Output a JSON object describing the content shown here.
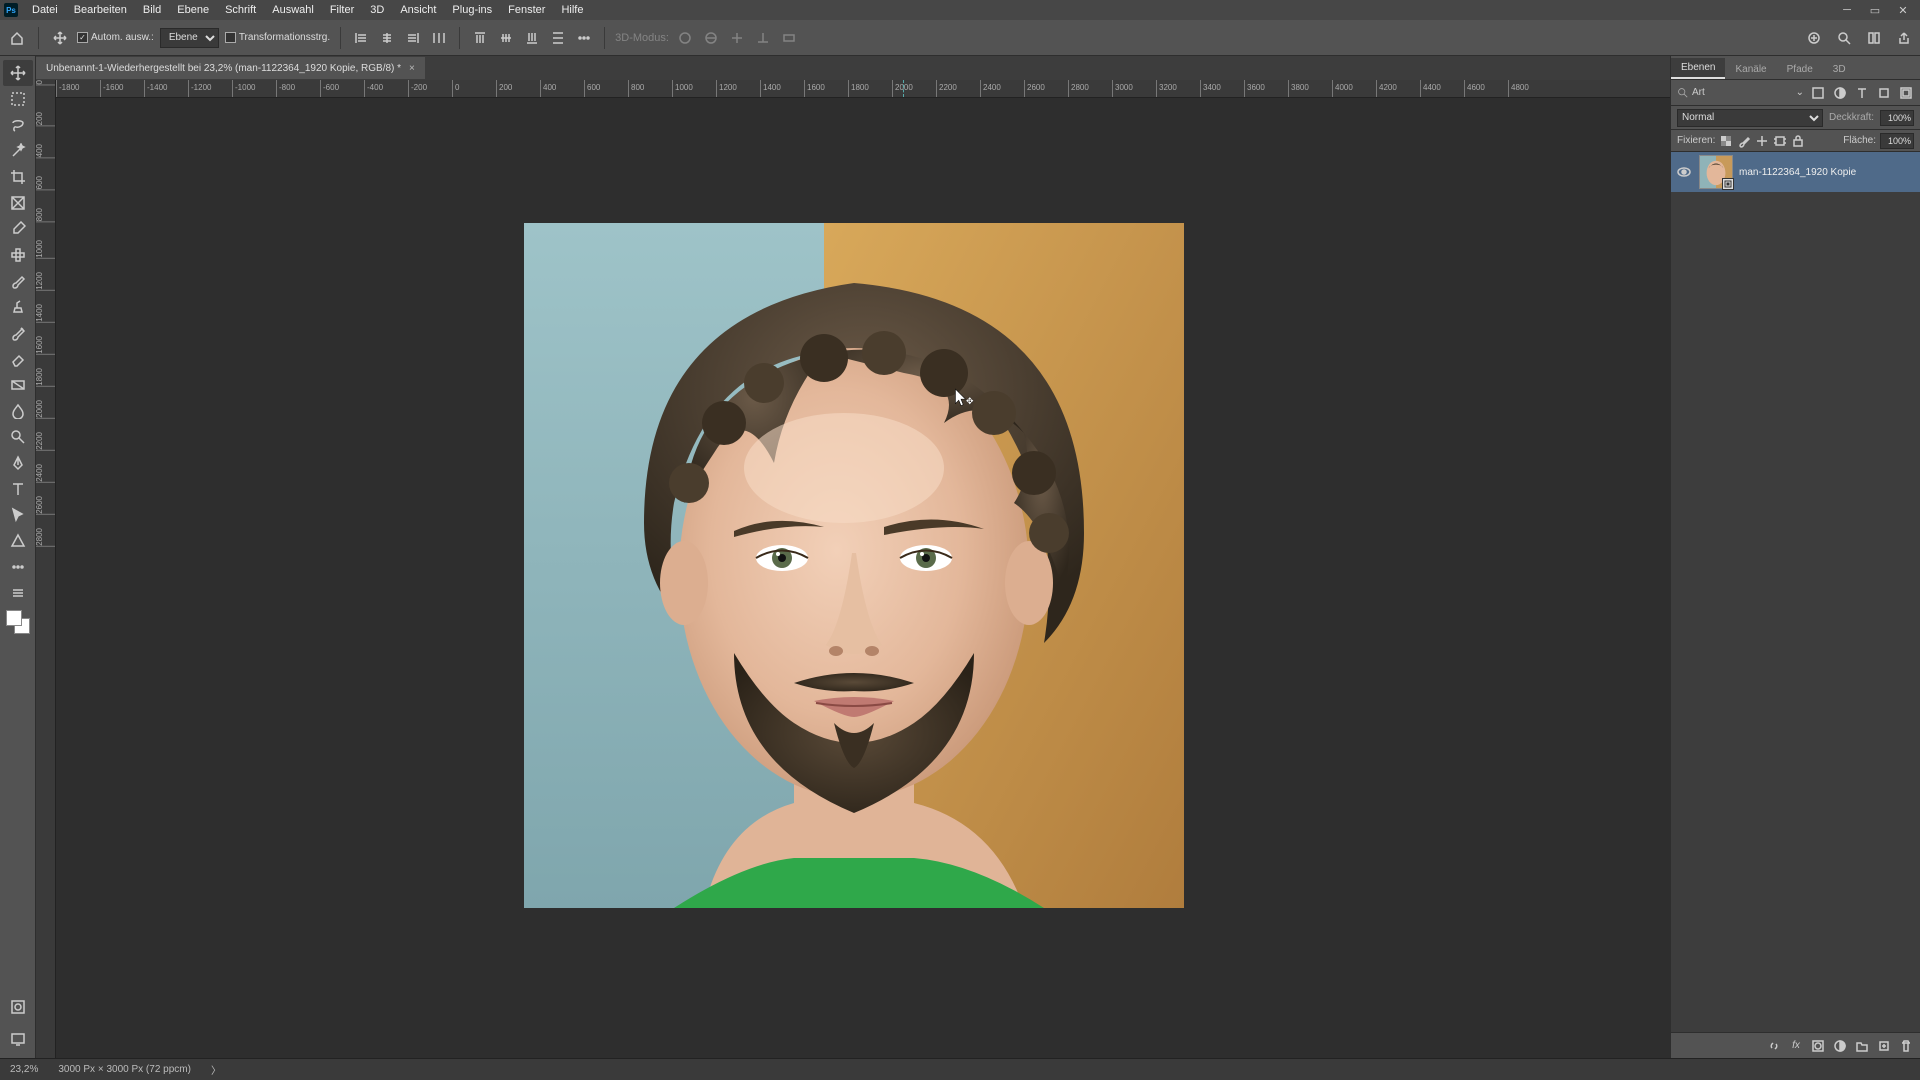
{
  "menubar": [
    "Datei",
    "Bearbeiten",
    "Bild",
    "Ebene",
    "Schrift",
    "Auswahl",
    "Filter",
    "3D",
    "Ansicht",
    "Plug-ins",
    "Fenster",
    "Hilfe"
  ],
  "options": {
    "auto_select_label": "Autom. ausw.:",
    "target_select_value": "Ebene",
    "transform_controls_label": "Transformationsstrg.",
    "mode3d_label": "3D-Modus:"
  },
  "document": {
    "tab_title": "Unbenannt-1-Wiederhergestellt bei 23,2% (man-1122364_1920 Kopie, RGB/8) *"
  },
  "ruler_h_marks": [
    -1800,
    -1600,
    -1400,
    -1200,
    -1000,
    -800,
    -600,
    -400,
    -200,
    0,
    200,
    400,
    600,
    800,
    1000,
    1200,
    1400,
    1600,
    1800,
    2000,
    2200,
    2400,
    2600,
    2800,
    3000,
    3200,
    3400,
    3600,
    3800,
    4000,
    4200,
    4400,
    4600,
    4800
  ],
  "ruler_h_marker_px": 903,
  "ruler_v_marks": [
    0,
    200,
    400,
    600,
    800,
    1000,
    1200,
    1400,
    1600,
    1800,
    2000,
    2200,
    2400,
    2600,
    2800
  ],
  "panel": {
    "tabs": [
      "Ebenen",
      "Kanäle",
      "Pfade",
      "3D"
    ],
    "active_tab": "Ebenen",
    "search_label": "Art",
    "blend_mode": "Normal",
    "opacity_label": "Deckkraft:",
    "opacity_value": "100%",
    "fill_label": "Fläche:",
    "fill_value": "100%",
    "lock_label": "Fixieren:"
  },
  "layers": [
    {
      "name": "man-1122364_1920 Kopie",
      "visible": true
    }
  ],
  "status": {
    "zoom": "23,2%",
    "doc_info": "3000 Px × 3000 Px (72 ppcm)"
  },
  "icons": {
    "ps": "Ps"
  }
}
